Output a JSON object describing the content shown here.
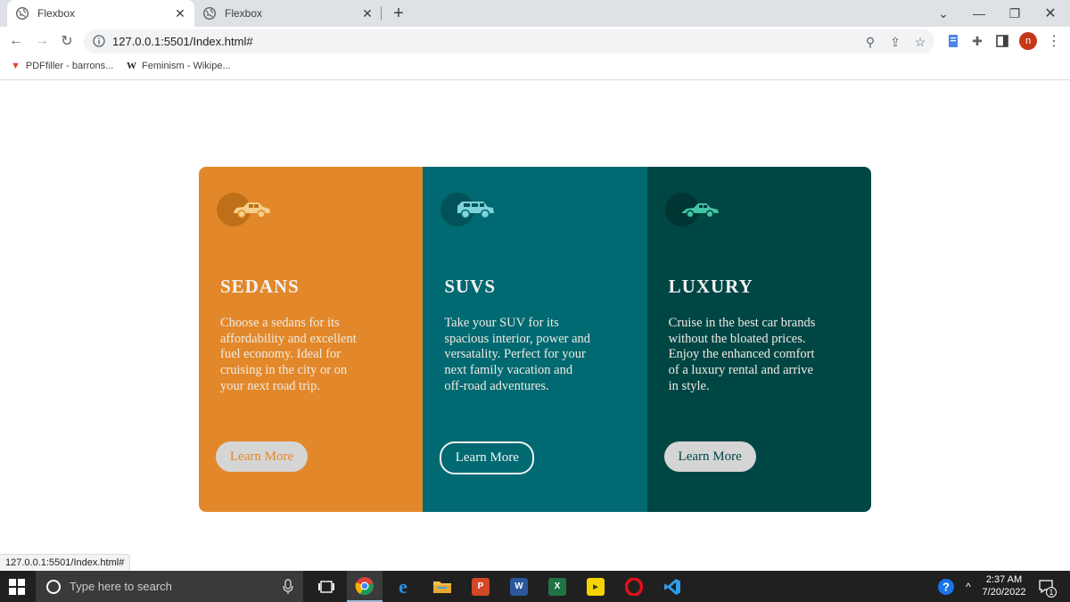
{
  "browser": {
    "tabs": [
      {
        "title": "Flexbox",
        "active": true
      },
      {
        "title": "Flexbox",
        "active": false
      }
    ],
    "url": "127.0.0.1:5501/Index.html#",
    "bookmarks": [
      {
        "label": "PDFfiller - barrons..."
      },
      {
        "label": "Feminism - Wikipe..."
      }
    ],
    "profile_initial": "n",
    "status_url": "127.0.0.1:5501/Index.html#"
  },
  "cards": [
    {
      "title": "SEDANS",
      "description": "Choose a sedans for its affordability and excellent fuel economy. Ideal for cruising in the city or on your next road trip.",
      "button": "Learn More",
      "colors": {
        "background": "#e3882a",
        "circle": "#c06f19",
        "car": "#f5d08a"
      }
    },
    {
      "title": "SUVS",
      "description": "Take your SUV for its spacious interior, power and versatality. Perfect for your next family vacation and off-road adventures.",
      "button": "Learn More",
      "colors": {
        "background": "#006971",
        "circle": "#015259",
        "car": "#7fd3da"
      }
    },
    {
      "title": "LUXURY",
      "description": "Cruise in the best car brands without the bloated prices. Enjoy the enhanced comfort of a luxury rental and arrive in style.",
      "button": "Learn More",
      "colors": {
        "background": "#004645",
        "circle": "#003534",
        "car": "#42c5a3"
      }
    }
  ],
  "taskbar": {
    "search_placeholder": "Type here to search",
    "time": "2:37 AM",
    "date": "7/20/2022",
    "notification_count": "1",
    "apps": [
      "task-view",
      "chrome",
      "edge",
      "file-explorer",
      "powerpoint",
      "word",
      "excel",
      "player",
      "opera",
      "vscode"
    ]
  }
}
